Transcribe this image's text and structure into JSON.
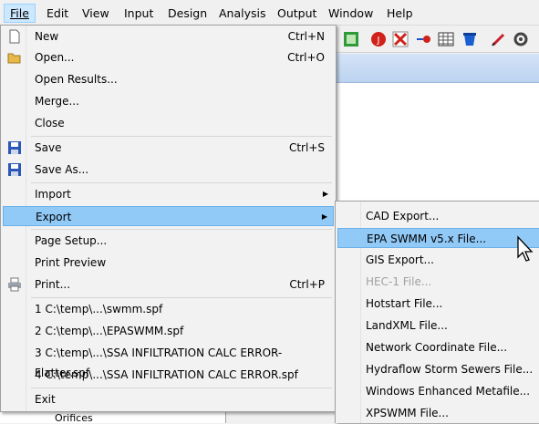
{
  "menubar": {
    "items": [
      {
        "label": "File",
        "active": true
      },
      {
        "label": "Edit"
      },
      {
        "label": "View"
      },
      {
        "label": "Input"
      },
      {
        "label": "Design"
      },
      {
        "label": "Analysis"
      },
      {
        "label": "Output"
      },
      {
        "label": "Window"
      },
      {
        "label": "Help"
      }
    ]
  },
  "file_menu": {
    "items": [
      {
        "label": "New",
        "shortcut": "Ctrl+N",
        "icon": "new-file-icon"
      },
      {
        "label": "Open...",
        "shortcut": "Ctrl+O",
        "icon": "open-folder-icon"
      },
      {
        "label": "Open Results..."
      },
      {
        "label": "Merge..."
      },
      {
        "label": "Close"
      },
      {
        "label": "Save",
        "shortcut": "Ctrl+S",
        "icon": "save-icon"
      },
      {
        "label": "Save As...",
        "icon": "save-as-icon"
      },
      {
        "label": "Import",
        "submenu": true
      },
      {
        "label": "Export",
        "submenu": true,
        "highlighted": true
      },
      {
        "label": "Page Setup..."
      },
      {
        "label": "Print Preview"
      },
      {
        "label": "Print...",
        "shortcut": "Ctrl+P",
        "icon": "printer-icon"
      },
      {
        "label": "1 C:\\temp\\...\\swmm.spf"
      },
      {
        "label": "2 C:\\temp\\...\\EPASWMM.spf"
      },
      {
        "label": "3 C:\\temp\\...\\SSA INFILTRATION CALC ERROR-Flatter.spf"
      },
      {
        "label": "4 C:\\temp\\...\\SSA INFILTRATION CALC ERROR.spf"
      },
      {
        "label": "Exit"
      }
    ]
  },
  "export_menu": {
    "items": [
      {
        "label": "CAD Export..."
      },
      {
        "label": "EPA SWMM v5.x File...",
        "highlighted": true
      },
      {
        "label": "GIS Export..."
      },
      {
        "label": "HEC-1 File...",
        "disabled": true
      },
      {
        "label": "Hotstart File..."
      },
      {
        "label": "LandXML File..."
      },
      {
        "label": "Network Coordinate File..."
      },
      {
        "label": "Hydraflow Storm Sewers File..."
      },
      {
        "label": "Windows Enhanced Metafile..."
      },
      {
        "label": "XPSWMM File..."
      }
    ]
  },
  "left_panel": {
    "partial_item": "Orifices"
  },
  "colors": {
    "menu_highlight": "#91c9f7",
    "menubar_active": "#cce8ff",
    "menu_bg": "#f2f2f2"
  }
}
